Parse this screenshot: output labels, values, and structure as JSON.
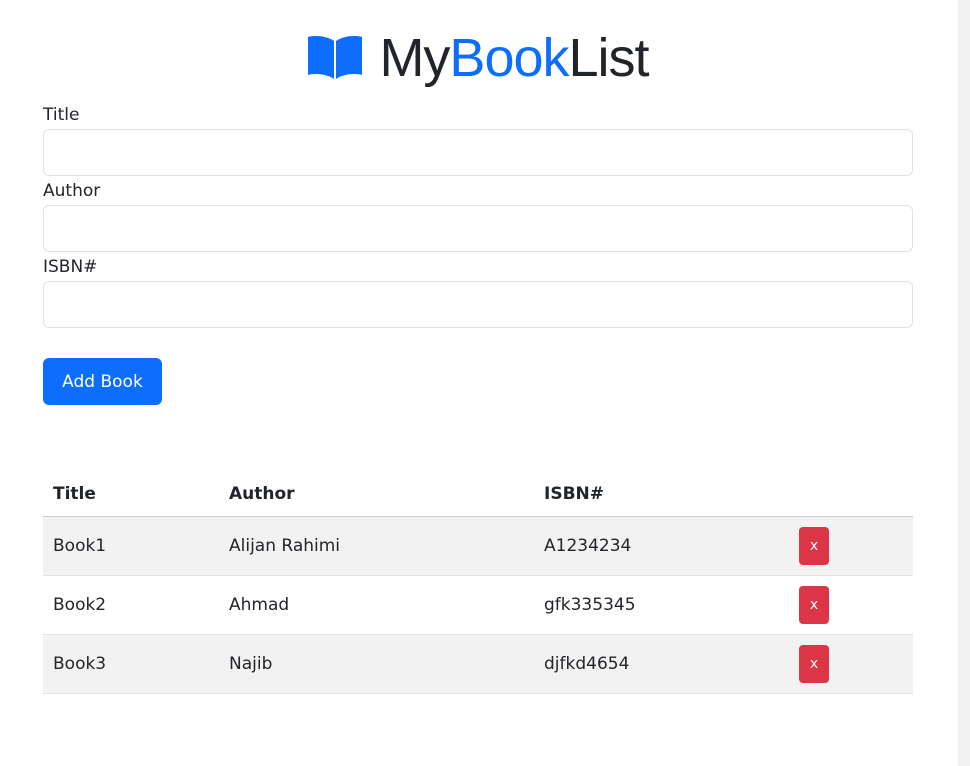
{
  "header": {
    "title_part1": "My",
    "title_part2": "Book",
    "title_part3": "List",
    "icon": "book-open-icon",
    "accent_color": "#0d6efd"
  },
  "form": {
    "title_label": "Title",
    "title_value": "",
    "author_label": "Author",
    "author_value": "",
    "isbn_label": "ISBN#",
    "isbn_value": "",
    "submit_label": "Add Book"
  },
  "table": {
    "headers": [
      "Title",
      "Author",
      "ISBN#",
      ""
    ],
    "rows": [
      {
        "title": "Book1",
        "author": "Alijan Rahimi",
        "isbn": "A1234234",
        "delete_label": "x"
      },
      {
        "title": "Book2",
        "author": "Ahmad",
        "isbn": "gfk335345",
        "delete_label": "x"
      },
      {
        "title": "Book3",
        "author": "Najib",
        "isbn": "djfkd4654",
        "delete_label": "x"
      }
    ],
    "delete_color": "#dc3545"
  }
}
